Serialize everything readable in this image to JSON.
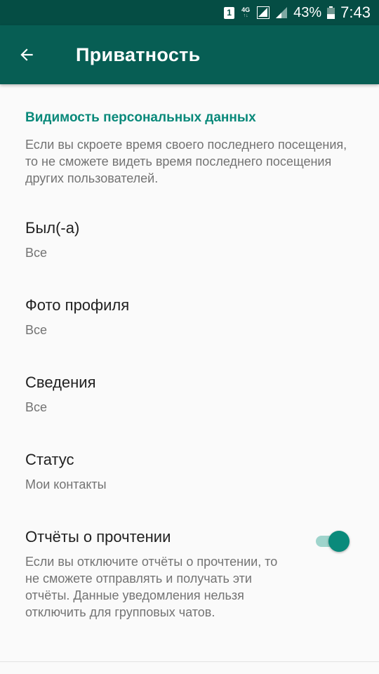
{
  "status_bar": {
    "sim_label": "1",
    "network_label": "4G",
    "battery_percent": "43%",
    "battery_level": 0.43,
    "time": "7:43"
  },
  "toolbar": {
    "back_icon": "arrow-back-icon",
    "title": "Приватность"
  },
  "section": {
    "header": "Видимость персональных данных",
    "description": "Если вы скроете время своего последнего посещения, то не сможете видеть время последнего посещения других пользователей."
  },
  "settings": [
    {
      "title": "Был(-а)",
      "value": "Все"
    },
    {
      "title": "Фото профиля",
      "value": "Все"
    },
    {
      "title": "Сведения",
      "value": "Все"
    },
    {
      "title": "Статус",
      "value": "Мои контакты"
    }
  ],
  "read_receipts": {
    "title": "Отчёты о прочтении",
    "description": "Если вы отключите отчёты о прочтении, то не сможете отправлять и получать эти отчёты. Данные уведомления нельзя отключить для групповых чатов.",
    "enabled": true
  },
  "colors": {
    "status_bar": "#054d44",
    "toolbar": "#075e54",
    "accent": "#09897a",
    "toggle_thumb": "#0a8a7b",
    "toggle_track": "#9fd4cc"
  }
}
